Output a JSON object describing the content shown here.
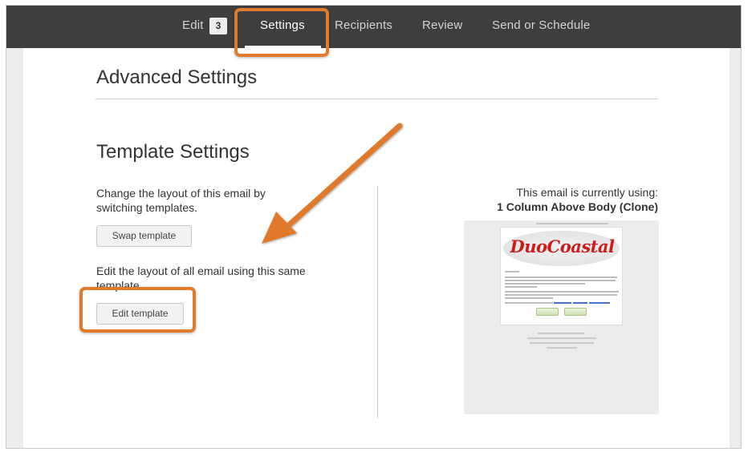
{
  "nav": {
    "edit_label": "Edit",
    "edit_count": "3",
    "items": [
      {
        "label": "Settings",
        "active": true
      },
      {
        "label": "Recipients",
        "active": false
      },
      {
        "label": "Review",
        "active": false
      },
      {
        "label": "Send or Schedule",
        "active": false
      }
    ]
  },
  "page": {
    "advanced_title": "Advanced Settings",
    "template_title": "Template Settings"
  },
  "template": {
    "switch_description": "Change the layout of this email by switching templates.",
    "swap_button": "Swap template",
    "edit_description": "Edit the layout of all email using this same template.",
    "edit_button": "Edit template",
    "using_label": "This email is currently using:",
    "using_name": "1 Column Above Body (Clone)"
  },
  "preview": {
    "logo_text": "DuoCoastal"
  },
  "colors": {
    "nav_bg": "#3e3e3e",
    "callout": "#e07a2c",
    "arrow": "#e07a2c",
    "logo_red": "#cc1d1d"
  }
}
